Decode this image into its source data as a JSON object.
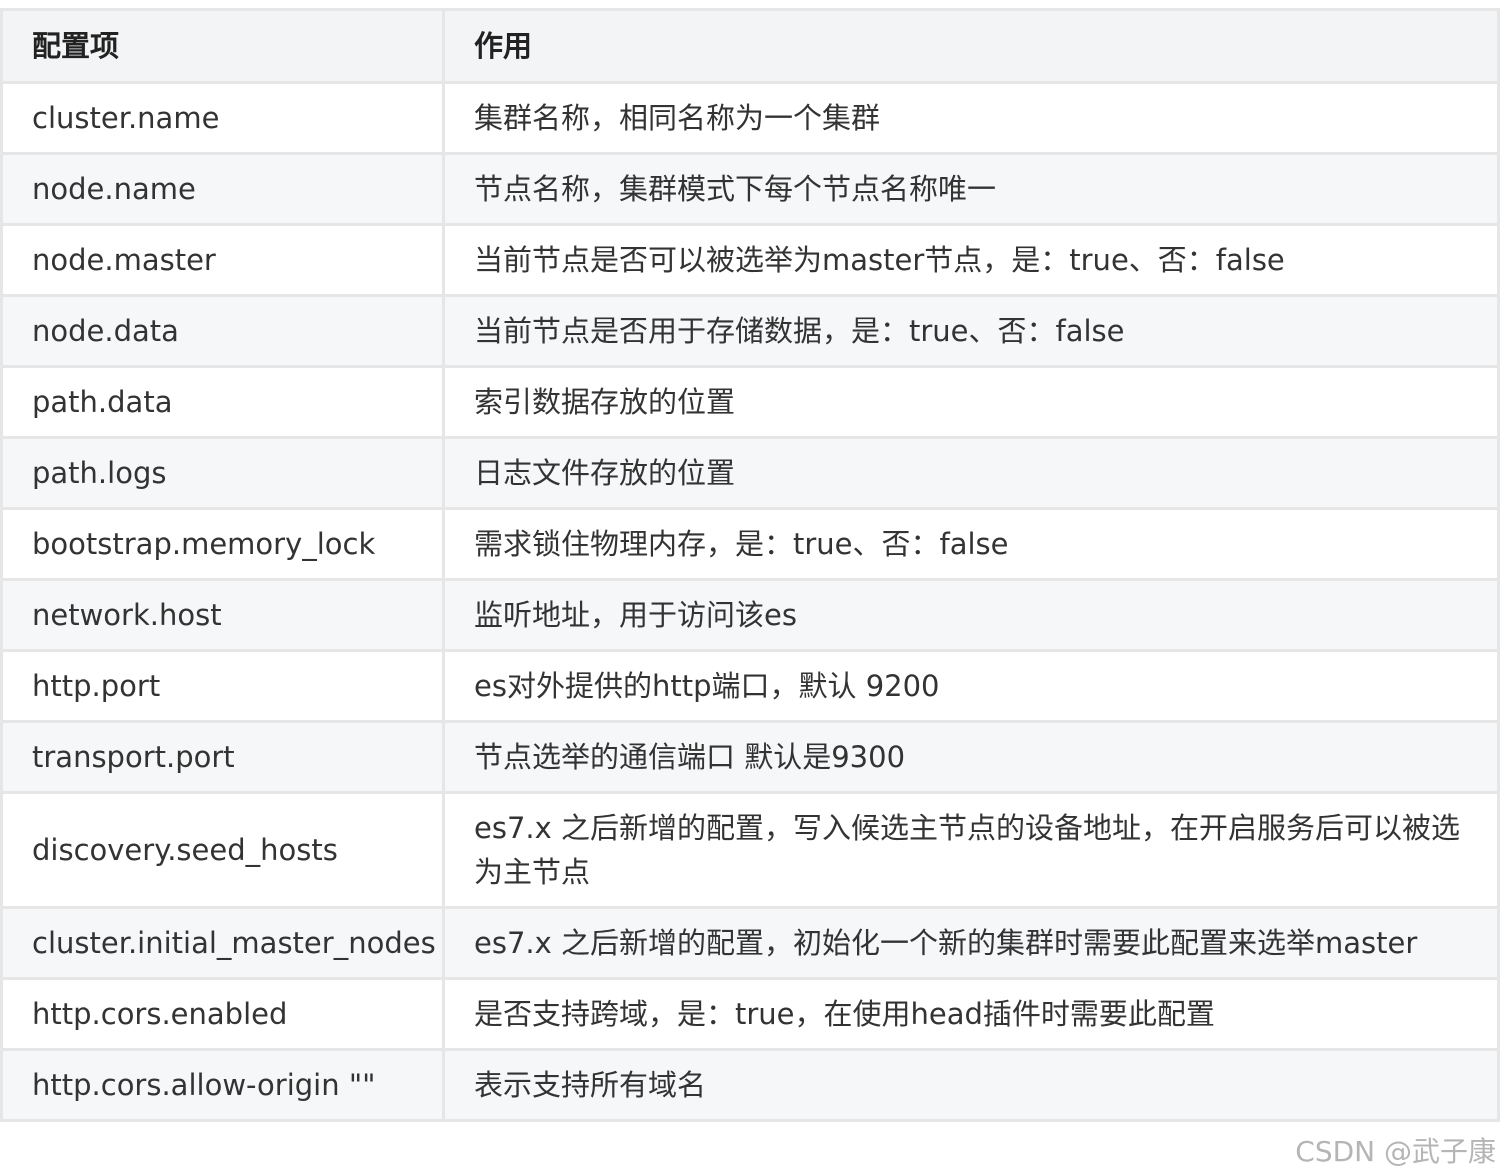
{
  "table": {
    "headers": [
      "配置项",
      "作用"
    ],
    "rows": [
      {
        "key": "cluster.name",
        "desc": "集群名称，相同名称为一个集群"
      },
      {
        "key": "node.name",
        "desc": "节点名称，集群模式下每个节点名称唯一"
      },
      {
        "key": "node.master",
        "desc": "当前节点是否可以被选举为master节点，是：true、否：false"
      },
      {
        "key": "node.data",
        "desc": "当前节点是否用于存储数据，是：true、否：false"
      },
      {
        "key": "path.data",
        "desc": "索引数据存放的位置"
      },
      {
        "key": "path.logs",
        "desc": "日志文件存放的位置"
      },
      {
        "key": "bootstrap.memory_lock",
        "desc": "需求锁住物理内存，是：true、否：false"
      },
      {
        "key": "network.host",
        "desc": "监听地址，用于访问该es"
      },
      {
        "key": "http.port",
        "desc": "es对外提供的http端口，默认 9200"
      },
      {
        "key": "transport.port",
        "desc": "节点选举的通信端口 默认是9300"
      },
      {
        "key": "discovery.seed_hosts",
        "desc": "es7.x 之后新增的配置，写入候选主节点的设备地址，在开启服务后可以被选为主节点"
      },
      {
        "key": "cluster.initial_master_nodes",
        "desc": "es7.x 之后新增的配置，初始化一个新的集群时需要此配置来选举master"
      },
      {
        "key": "http.cors.enabled",
        "desc": "是否支持跨域，是：true，在使用head插件时需要此配置"
      },
      {
        "key": "http.cors.allow-origin \"\"",
        "desc": "表示支持所有域名"
      }
    ]
  },
  "watermark": "CSDN @武子康"
}
